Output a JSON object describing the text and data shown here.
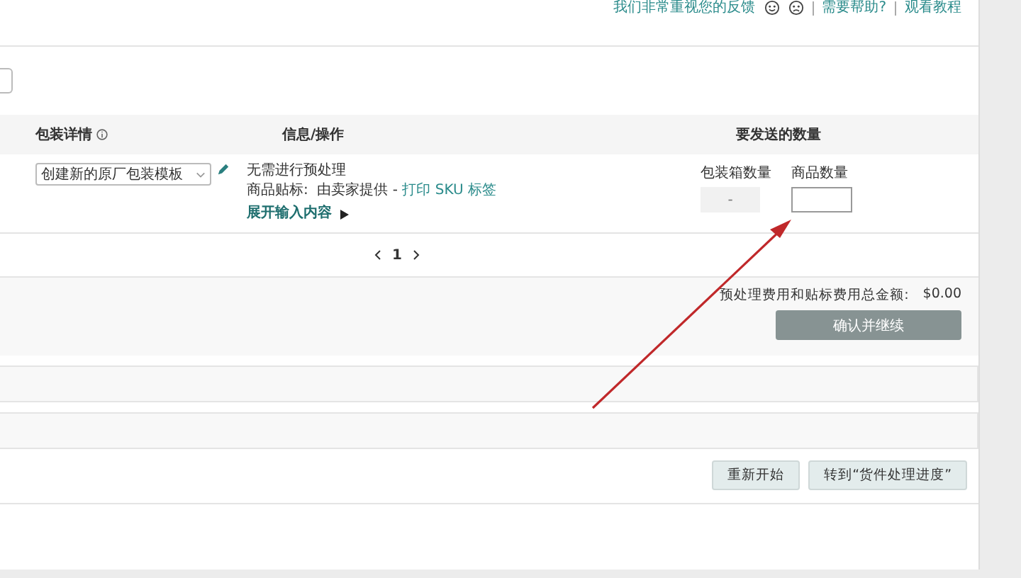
{
  "header_links": {
    "feedback": "我们非常重视您的反馈",
    "help": "需要帮助?",
    "tutorial": "观看教程"
  },
  "table": {
    "columns": [
      {
        "label": "包装详情",
        "info": true
      },
      {
        "label": "信息/操作",
        "info": false
      },
      {
        "label": "要发送的数量",
        "info": false
      }
    ],
    "rows": [
      {
        "packing_template": "创建新的原厂包装模板",
        "prep": "无需进行预处理",
        "labeling_label": "商品贴标:",
        "labeling_value": "由卖家提供 - ",
        "labeling_link": "打印 SKU 标签",
        "expand": "展开输入内容",
        "box_qty_label": "包装箱数量",
        "box_qty": "-",
        "unit_qty_label": "商品数量",
        "unit_qty": ""
      }
    ]
  },
  "pagination": {
    "pages": [
      {
        "label": "1",
        "selected": true
      }
    ]
  },
  "summary": {
    "total_label": "预处理费用和贴标费用总金额:",
    "total": "$0.00",
    "confirm_button": "确认并继续"
  },
  "buttons": [
    "重新开始",
    "转到“货件处理进度”"
  ]
}
